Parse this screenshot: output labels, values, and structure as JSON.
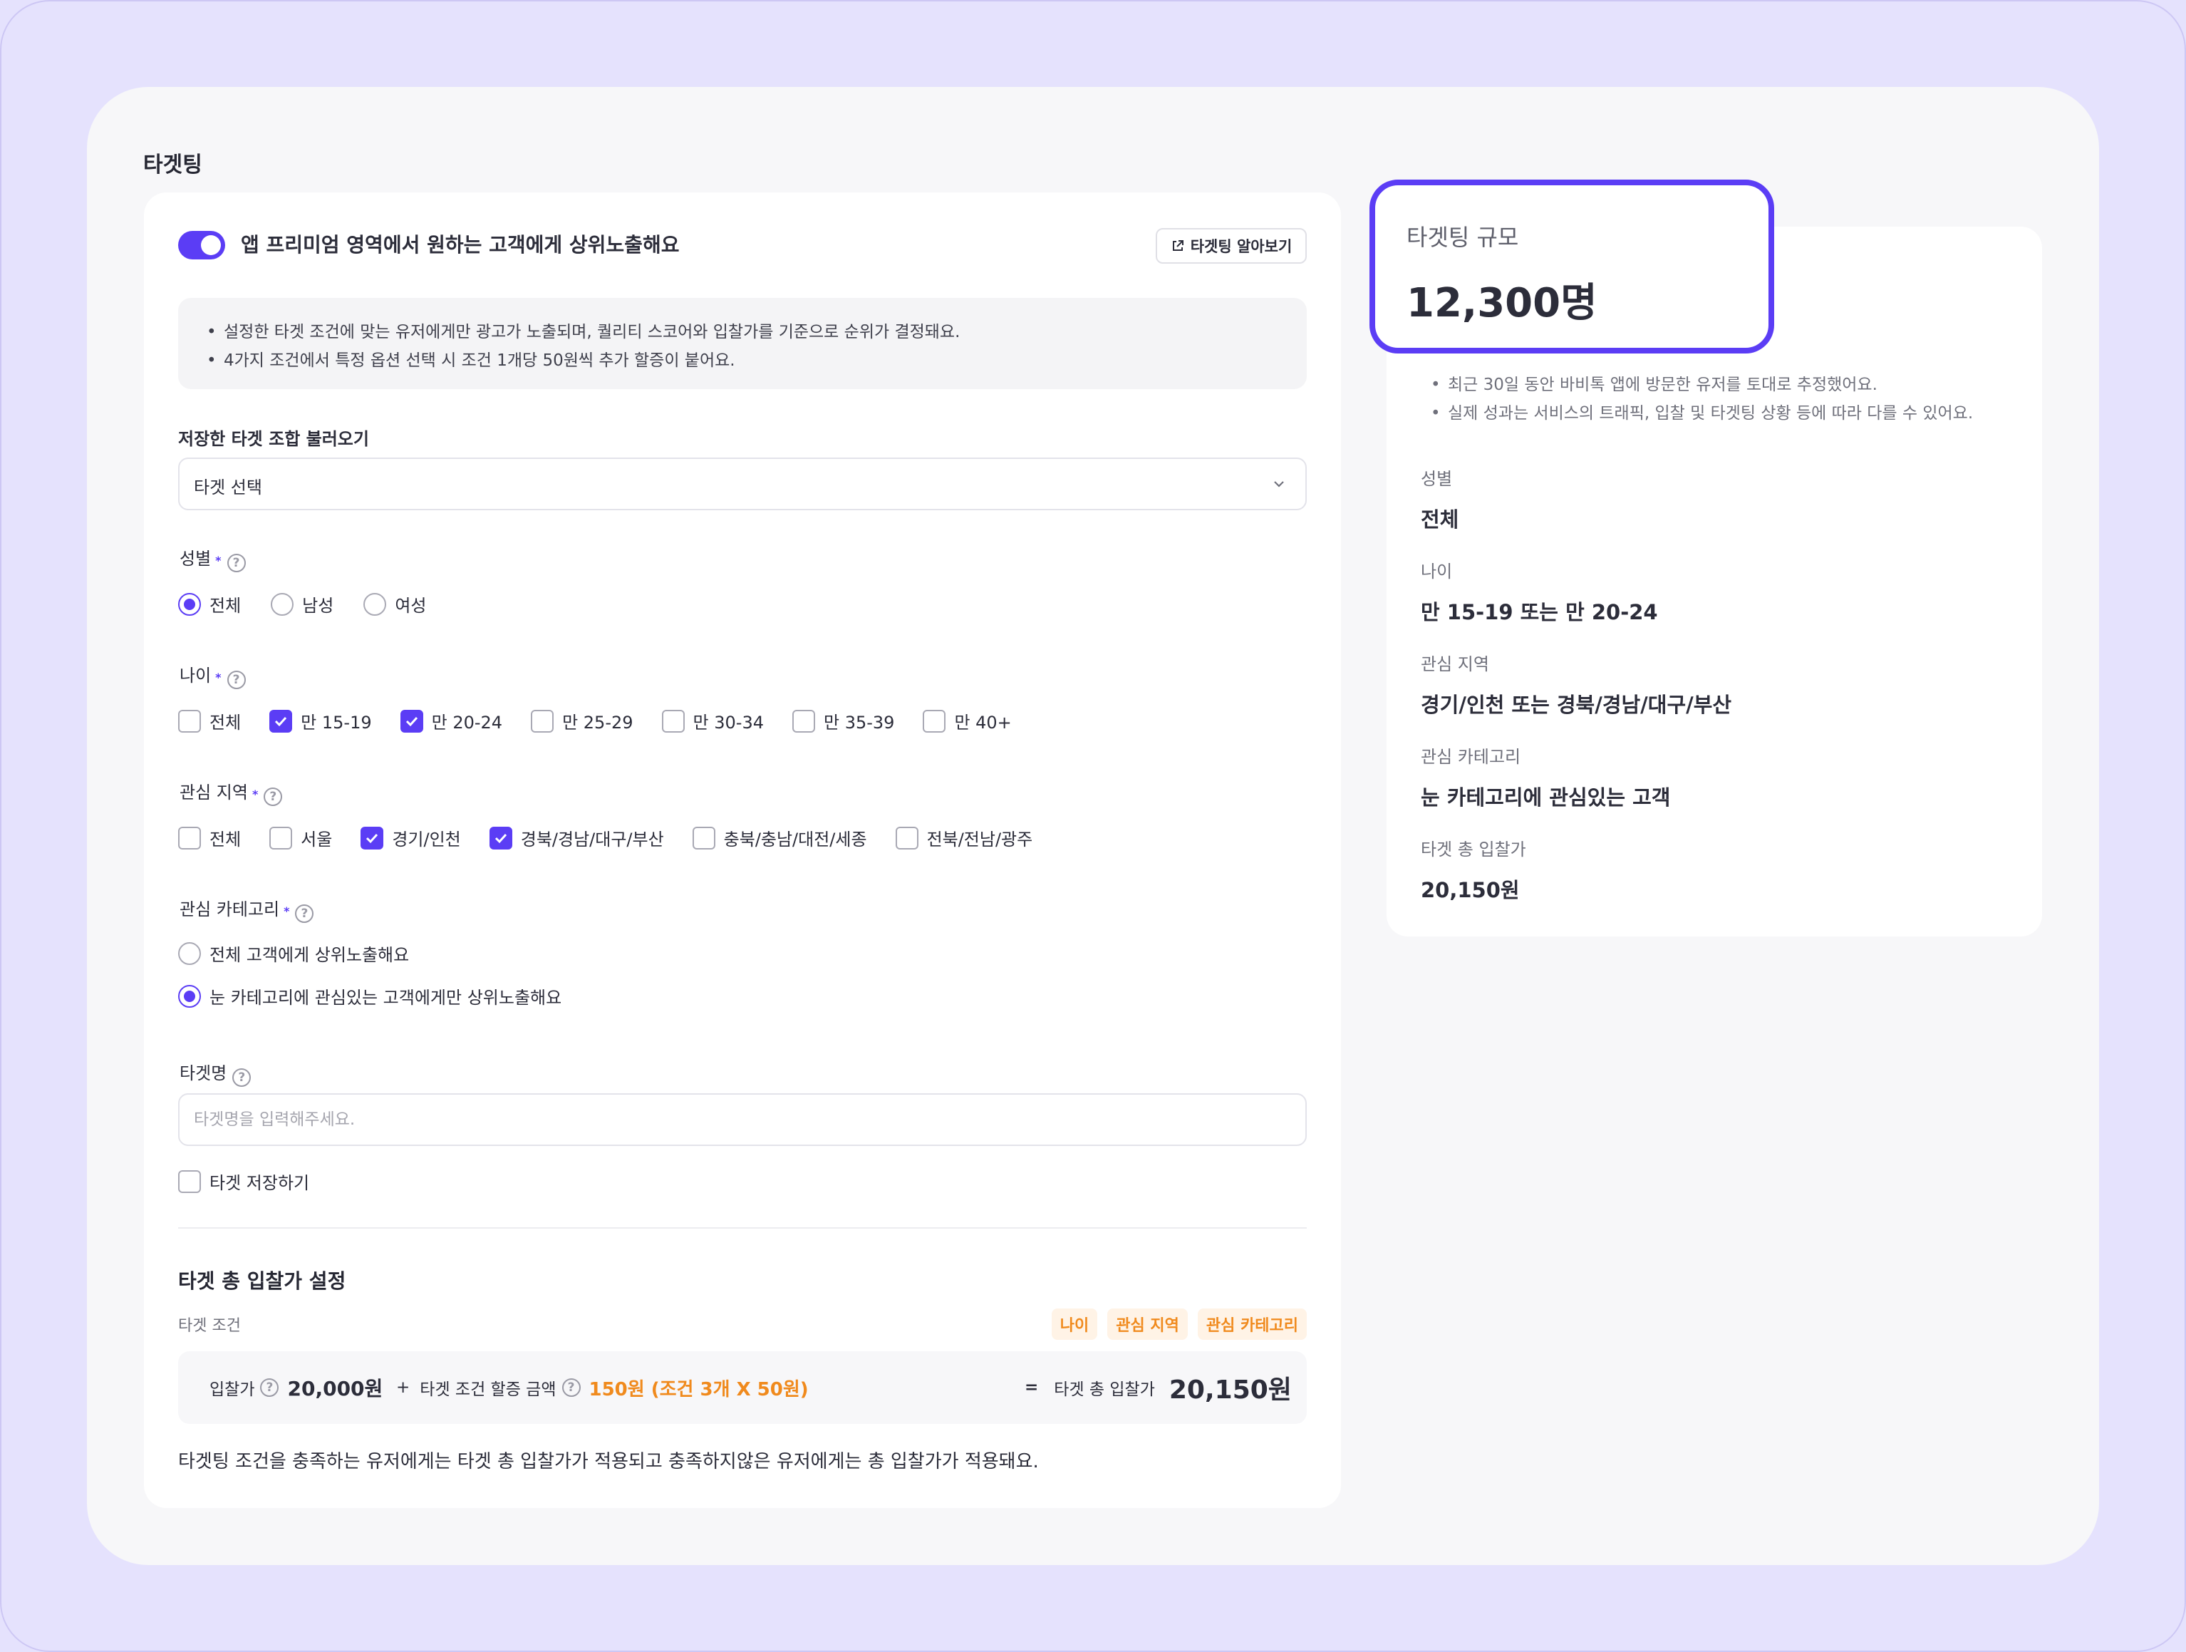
{
  "section_title": "타겟팅",
  "toggle": {
    "label": "앱 프리미엄 영역에서 원하는 고객에게 상위노출해요",
    "on": true
  },
  "guide_button": "타겟팅 알아보기",
  "notice": [
    "설정한 타겟 조건에 맞는 유저에게만 광고가 노출되며, 퀄리티 스코어와 입찰가를 기준으로 순위가 결정돼요.",
    "4가지 조건에서 특정 옵션 선택 시 조건 1개당 50원씩 추가 할증이 붙어요."
  ],
  "saved_target": {
    "label": "저장한 타겟 조합 불러오기",
    "value": "타겟 선택"
  },
  "gender": {
    "label": "성별",
    "options": [
      {
        "label": "전체",
        "selected": true
      },
      {
        "label": "남성",
        "selected": false
      },
      {
        "label": "여성",
        "selected": false
      }
    ]
  },
  "age": {
    "label": "나이",
    "options": [
      {
        "label": "전체",
        "checked": false
      },
      {
        "label": "만 15-19",
        "checked": true
      },
      {
        "label": "만 20-24",
        "checked": true
      },
      {
        "label": "만 25-29",
        "checked": false
      },
      {
        "label": "만 30-34",
        "checked": false
      },
      {
        "label": "만 35-39",
        "checked": false
      },
      {
        "label": "만 40+",
        "checked": false
      }
    ]
  },
  "region": {
    "label": "관심 지역",
    "options": [
      {
        "label": "전체",
        "checked": false
      },
      {
        "label": "서울",
        "checked": false
      },
      {
        "label": "경기/인천",
        "checked": true
      },
      {
        "label": "경북/경남/대구/부산",
        "checked": true
      },
      {
        "label": "충북/충남/대전/세종",
        "checked": false
      },
      {
        "label": "전북/전남/광주",
        "checked": false
      }
    ]
  },
  "category": {
    "label": "관심 카테고리",
    "options": [
      {
        "label": "전체 고객에게 상위노출해요",
        "selected": false
      },
      {
        "label": "눈 카테고리에 관심있는 고객에게만 상위노출해요",
        "selected": true
      }
    ]
  },
  "target_name": {
    "label": "타겟명",
    "placeholder": "타겟명을 입력해주세요.",
    "value": ""
  },
  "save_target": {
    "label": "타겟 저장하기",
    "checked": false
  },
  "bid": {
    "title": "타겟 총 입찰가 설정",
    "condition_label": "타겟 조건",
    "tags": [
      "나이",
      "관심 지역",
      "관심 카테고리"
    ],
    "base_label": "입찰가",
    "base_value": "20,000원",
    "plus": "+",
    "surcharge_label": "타겟 조건 할증 금액",
    "surcharge_value": "150원 (조건 3개 X 50원)",
    "equals": "=",
    "total_label": "타겟 총 입찰가",
    "total_value": "20,150원",
    "note": "타겟팅 조건을 충족하는 유저에게는 타겟 총 입찰가가 적용되고 충족하지않은 유저에게는 총 입찰가가 적용돼요."
  },
  "summary": {
    "size_title": "타겟팅 규모",
    "size_value": "12,300명",
    "notes": [
      "최근 30일 동안 바비톡 앱에 방문한 유저를 토대로 추정했어요.",
      "실제 성과는 서비스의 트래픽, 입찰 및 타겟팅 상황 등에 따라 다를 수 있어요."
    ],
    "items": [
      {
        "key": "성별",
        "value": "전체"
      },
      {
        "key": "나이",
        "value": "만 15-19 또는 만 20-24"
      },
      {
        "key": "관심 지역",
        "value": "경기/인천 또는 경북/경남/대구/부산"
      },
      {
        "key": "관심 카테고리",
        "value": "눈 카테고리에 관심있는 고객"
      },
      {
        "key": "타겟 총 입찰가",
        "value": "20,150원"
      }
    ]
  },
  "colors": {
    "accent": "#5b3df5",
    "orange": "#f08a1d",
    "background": "#e5e2fd"
  },
  "icons": {
    "guide": "external-link-icon",
    "select": "chevron-down-icon",
    "help": "question-circle-icon",
    "check": "check-icon"
  }
}
